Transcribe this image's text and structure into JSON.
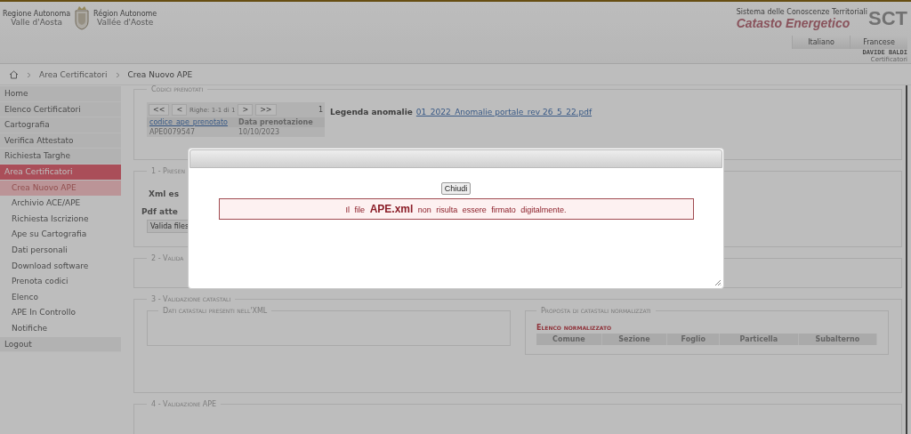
{
  "header": {
    "logo_left": {
      "caption": "Regione Autonoma",
      "name": "Valle d'Aosta"
    },
    "logo_right": {
      "caption": "Région Autonome",
      "name": "Vallée d'Aoste"
    },
    "system_caption": "Sistema delle Conoscenze Territoriali",
    "product": "Catasto Energetico",
    "product_mark": "SCT",
    "languages": [
      "Italiano",
      "Francese"
    ],
    "user": {
      "name": "DAVIDE BALDI",
      "role": "Certificatori"
    }
  },
  "breadcrumb": [
    "Area Certificatori",
    "Crea Nuovo APE"
  ],
  "sidebar": {
    "items": [
      {
        "label": "Home",
        "selected": false
      },
      {
        "label": "Elenco Certificatori",
        "selected": false
      },
      {
        "label": "Cartografia",
        "selected": false
      },
      {
        "label": "Verifica Attestato",
        "selected": false
      },
      {
        "label": "Richiesta Targhe",
        "selected": false
      },
      {
        "label": "Area Certificatori",
        "selected": true,
        "children": [
          {
            "label": "Crea Nuovo APE",
            "selected": true
          },
          {
            "label": "Archivio ACE/APE",
            "selected": false
          },
          {
            "label": "Richiesta Iscrizione",
            "selected": false
          },
          {
            "label": "Ape su Cartografia",
            "selected": false
          },
          {
            "label": "Dati personali",
            "selected": false
          },
          {
            "label": "Download software",
            "selected": false
          },
          {
            "label": "Prenota codici",
            "selected": false
          },
          {
            "label": "Elenco",
            "selected": false
          },
          {
            "label": "APE In Controllo",
            "selected": false
          },
          {
            "label": "Notifiche",
            "selected": false
          }
        ]
      },
      {
        "label": "Logout",
        "selected": false
      }
    ]
  },
  "reserved_codes": {
    "legend": "Codici prenotati",
    "pager": {
      "first": "<<",
      "prev": "<",
      "info": "Righe: 1-1 di 1",
      "next": ">",
      "last": ">>",
      "page": "1"
    },
    "columns": [
      "codice_ape_prenotato",
      "Data prenotazione"
    ],
    "rows": [
      [
        "APE0079547",
        "10/10/2023"
      ]
    ],
    "anomalies_label": "Legenda anomalie",
    "anomalies_link": "01_2022_Anomalie portale_rev 26_5_22.pdf"
  },
  "section_1": {
    "legend": "1 - Presen",
    "xml_label": "Xml es",
    "pdf_label": "Pdf atte",
    "validate_button": "Valida files"
  },
  "section_2": {
    "legend": "2 - Valida"
  },
  "section_3": {
    "legend": "3 - Validazione catastali",
    "xml_data_legend": "Dati catastali presenti nell'XML",
    "proposal_legend": "Proposta di catastali normalizzati",
    "list_title": "Elenco normalizzato",
    "columns": [
      "Comune",
      "Sezione",
      "Foglio",
      "Particella",
      "Subalterno"
    ]
  },
  "section_4": {
    "legend": "4 - Validazione APE"
  },
  "dialog": {
    "close_button": "Chiudi",
    "message": "Il file **APE.xml** non risulta essere firmato digitalmente."
  }
}
